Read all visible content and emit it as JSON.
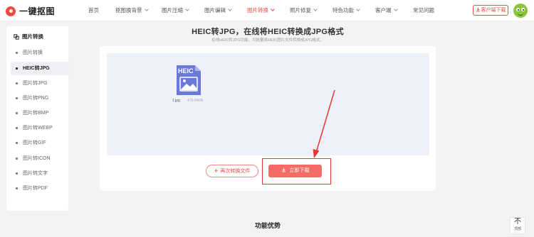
{
  "header": {
    "logo_text": "一键抠图",
    "nav": [
      {
        "label": "首页",
        "dropdown": false,
        "active": false
      },
      {
        "label": "抠图换背景",
        "dropdown": true,
        "active": false
      },
      {
        "label": "图片压缩",
        "dropdown": true,
        "active": false
      },
      {
        "label": "图片编辑",
        "dropdown": true,
        "active": false
      },
      {
        "label": "图片转换",
        "dropdown": true,
        "active": true
      },
      {
        "label": "照片修复",
        "dropdown": true,
        "active": false
      },
      {
        "label": "特色功能",
        "dropdown": true,
        "active": false
      },
      {
        "label": "客户端",
        "dropdown": true,
        "active": false
      },
      {
        "label": "常见问题",
        "dropdown": false,
        "active": false
      }
    ],
    "download_label": "客户端下载"
  },
  "sidebar": {
    "title": "图片转换",
    "items": [
      {
        "label": "图片转换",
        "active": false
      },
      {
        "label": "HEIC转JPG",
        "active": true
      },
      {
        "label": "图片转JPG",
        "active": false
      },
      {
        "label": "图片转PNG",
        "active": false
      },
      {
        "label": "图片转BMP",
        "active": false
      },
      {
        "label": "图片转WEBP",
        "active": false
      },
      {
        "label": "图片转GIF",
        "active": false
      },
      {
        "label": "图片转ICON",
        "active": false
      },
      {
        "label": "图片转文字",
        "active": false
      },
      {
        "label": "图片转PDF",
        "active": false
      }
    ]
  },
  "main": {
    "title": "HEIC转JPG，在线将HEIC转换成JPG格式",
    "subtitle": "在线HEIC转JPG功能，可批量将HEIC图片文件转换成JPG格式。",
    "file": {
      "badge": "HEIC",
      "name": "1.jpg",
      "size": "479.04KB"
    },
    "convert_again_label": "再次转换文件",
    "download_now_label": "立即下载"
  },
  "features_title": "功能优势",
  "back_to_top": {
    "glyph": "不",
    "label": "顶部"
  },
  "colors": {
    "accent": "#f04a42",
    "download_button": "#f36d66",
    "drop_area": "#eef1f8",
    "file_icon": "#6b79d6",
    "annotation": "#e53935"
  }
}
